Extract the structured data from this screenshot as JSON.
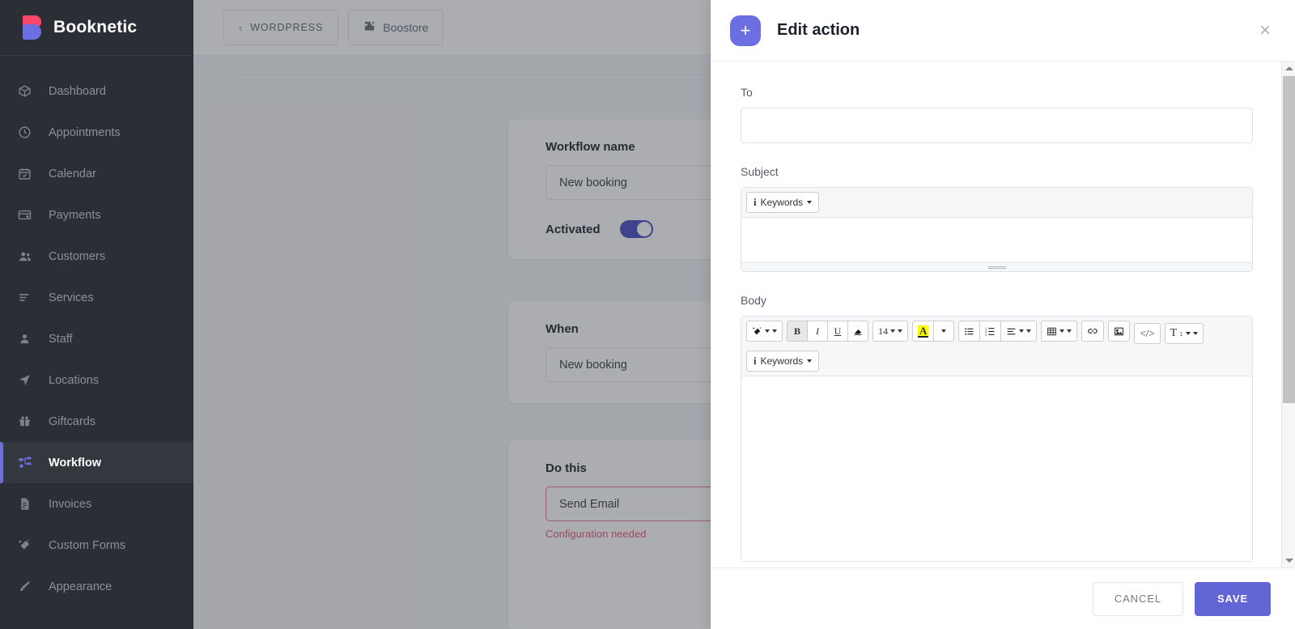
{
  "brand": {
    "name": "Booknetic"
  },
  "sidebar": {
    "items": [
      {
        "label": "Dashboard",
        "icon": "box-icon",
        "active": false
      },
      {
        "label": "Appointments",
        "icon": "clock-icon",
        "active": false
      },
      {
        "label": "Calendar",
        "icon": "calendar-icon",
        "active": false
      },
      {
        "label": "Payments",
        "icon": "wallet-icon",
        "active": false
      },
      {
        "label": "Customers",
        "icon": "users-icon",
        "active": false
      },
      {
        "label": "Services",
        "icon": "list-icon",
        "active": false
      },
      {
        "label": "Staff",
        "icon": "user-icon",
        "active": false
      },
      {
        "label": "Locations",
        "icon": "navigation-icon",
        "active": false
      },
      {
        "label": "Giftcards",
        "icon": "gift-icon",
        "active": false
      },
      {
        "label": "Workflow",
        "icon": "workflow-icon",
        "active": true
      },
      {
        "label": "Invoices",
        "icon": "document-icon",
        "active": false
      },
      {
        "label": "Custom Forms",
        "icon": "magic-wand-icon",
        "active": false
      },
      {
        "label": "Appearance",
        "icon": "brush-icon",
        "active": false
      }
    ]
  },
  "topbar": {
    "back_label": "WORDPRESS",
    "boostore_label": "Boostore"
  },
  "workflow": {
    "name_label": "Workflow name",
    "name_value": "New booking",
    "activated_label": "Activated",
    "activated": true,
    "when_label": "When",
    "when_value": "New booking",
    "do_this_label": "Do this",
    "do_this_value": "Send Email",
    "do_this_error": "Configuration needed"
  },
  "modal": {
    "title": "Edit action",
    "plus_glyph": "+",
    "close_glyph": "×",
    "fields": {
      "to_label": "To",
      "to_value": "",
      "subject_label": "Subject",
      "body_label": "Body"
    },
    "subject_editor": {
      "keywords_label": "Keywords",
      "info_glyph": "i",
      "content": ""
    },
    "body_editor": {
      "font_size": "14",
      "bold_label": "B",
      "italic_label": "I",
      "underline_label": "U",
      "code_label": "</>",
      "text_color_label": "A",
      "keywords_label": "Keywords",
      "info_glyph": "i",
      "para_label": "T",
      "content": "",
      "tools_row1": [
        "magic-wand-style-icon",
        "bold-icon",
        "italic-icon",
        "underline-icon",
        "eraser-icon",
        "font-size-icon",
        "text-color-icon",
        "unordered-list-icon",
        "ordered-list-icon",
        "paragraph-align-icon",
        "table-icon",
        "link-icon",
        "picture-icon"
      ],
      "tools_row2": [
        "code-view-icon",
        "line-height-icon",
        "keywords-dropdown"
      ]
    },
    "footer": {
      "cancel_label": "CANCEL",
      "save_label": "SAVE"
    }
  },
  "colors": {
    "accent": "#6c6fe0",
    "sidebar_bg": "#2b2f35",
    "error": "#e05c77",
    "highlight": "#ffff00"
  }
}
